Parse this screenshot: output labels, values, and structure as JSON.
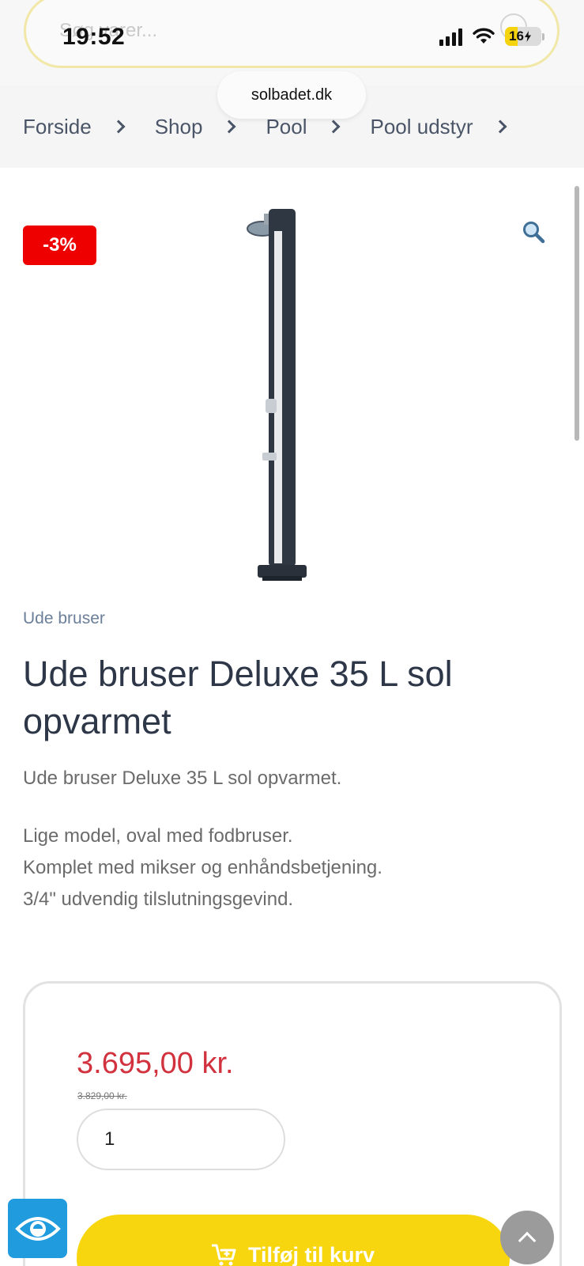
{
  "status_bar": {
    "time": "19:52",
    "battery": "16"
  },
  "search": {
    "placeholder": "Søg varer..."
  },
  "url": "solbadet.dk",
  "breadcrumb": {
    "items": [
      "Forside",
      "Shop",
      "Pool",
      "Pool udstyr"
    ]
  },
  "product": {
    "discount_badge": "-3%",
    "category": "Ude bruser",
    "title": "Ude bruser Deluxe 35 L sol opvarmet",
    "short_description": "Ude bruser Deluxe 35 L sol opvarmet.",
    "description_lines": [
      "Lige model, oval med fodbruser.",
      "Komplet med mikser og enhåndsbetjening.",
      "3/4\" udvendig tilslutningsgevind."
    ],
    "price": "3.695,00 kr.",
    "old_price": "3.829,00 kr.",
    "quantity": "1",
    "add_to_cart_label": "Tilføj til kurv"
  },
  "colors": {
    "accent_yellow": "#f7d60f",
    "sale_red": "#d1323e",
    "badge_red": "#ee0000",
    "a11y_blue": "#1f9bde"
  },
  "icons": {
    "zoom": "magnifier-icon",
    "cart": "cart-plus-icon",
    "accessibility": "eye-icon",
    "back_to_top": "chevron-up-icon"
  }
}
